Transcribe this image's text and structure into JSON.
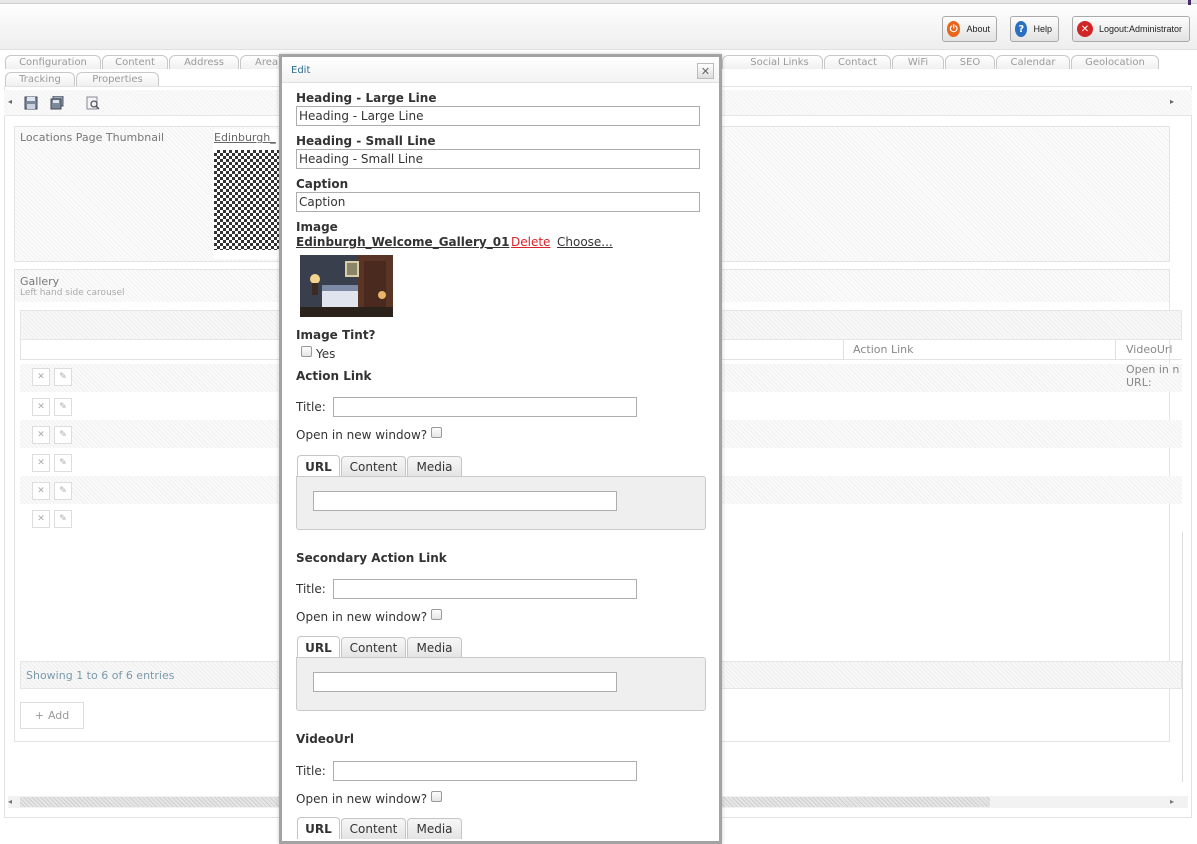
{
  "header": {
    "buttons": [
      {
        "label": "About",
        "icon": "power-icon",
        "color": "#e8661b"
      },
      {
        "label": "Help",
        "icon": "help-icon",
        "color": "#2a6fc0"
      },
      {
        "label": "Logout:Administrator",
        "icon": "close-icon",
        "color": "#d02626"
      }
    ]
  },
  "tabs": {
    "row1": [
      "Configuration",
      "Content",
      "Address",
      "Area",
      "Social Links",
      "Contact",
      "WiFi",
      "SEO",
      "Calendar",
      "Geolocation"
    ],
    "row2": [
      "Tracking",
      "Properties"
    ]
  },
  "editor": {
    "thumbnail_label": "Locations Page Thumbnail",
    "thumbnail_file": "Edinburgh_",
    "gallery_title": "Gallery",
    "gallery_subtitle": "Left hand side carousel",
    "columns": {
      "action_link": "Action Link",
      "video_url": "VideoUrl"
    },
    "row_text": "Open in n",
    "row_url": "URL:",
    "showing": "Showing 1 to 6 of 6 entries",
    "add_label": "Add",
    "row_count": 6
  },
  "modal": {
    "title": "Edit",
    "heading_large": {
      "label": "Heading - Large Line",
      "value": "Heading - Large Line"
    },
    "heading_small": {
      "label": "Heading - Small Line",
      "value": "Heading - Small Line"
    },
    "caption": {
      "label": "Caption",
      "value": "Caption"
    },
    "image": {
      "label": "Image",
      "file": "Edinburgh_Welcome_Gallery_01",
      "delete": "Delete",
      "choose": "Choose..."
    },
    "image_tint": {
      "label": "Image Tint?",
      "option": "Yes"
    },
    "sections": [
      {
        "title": "Action Link",
        "title_label": "Title:",
        "new_window": "Open in new window?",
        "tabs": [
          "URL",
          "Content",
          "Media"
        ]
      },
      {
        "title": "Secondary Action Link",
        "title_label": "Title:",
        "new_window": "Open in new window?",
        "tabs": [
          "URL",
          "Content",
          "Media"
        ]
      },
      {
        "title": "VideoUrl",
        "title_label": "Title:",
        "new_window": "Open in new window?",
        "tabs": [
          "URL",
          "Content",
          "Media"
        ]
      }
    ]
  },
  "colors": {
    "link": "#333333",
    "delete": "#d9232a",
    "title": "#2e6e8e"
  }
}
